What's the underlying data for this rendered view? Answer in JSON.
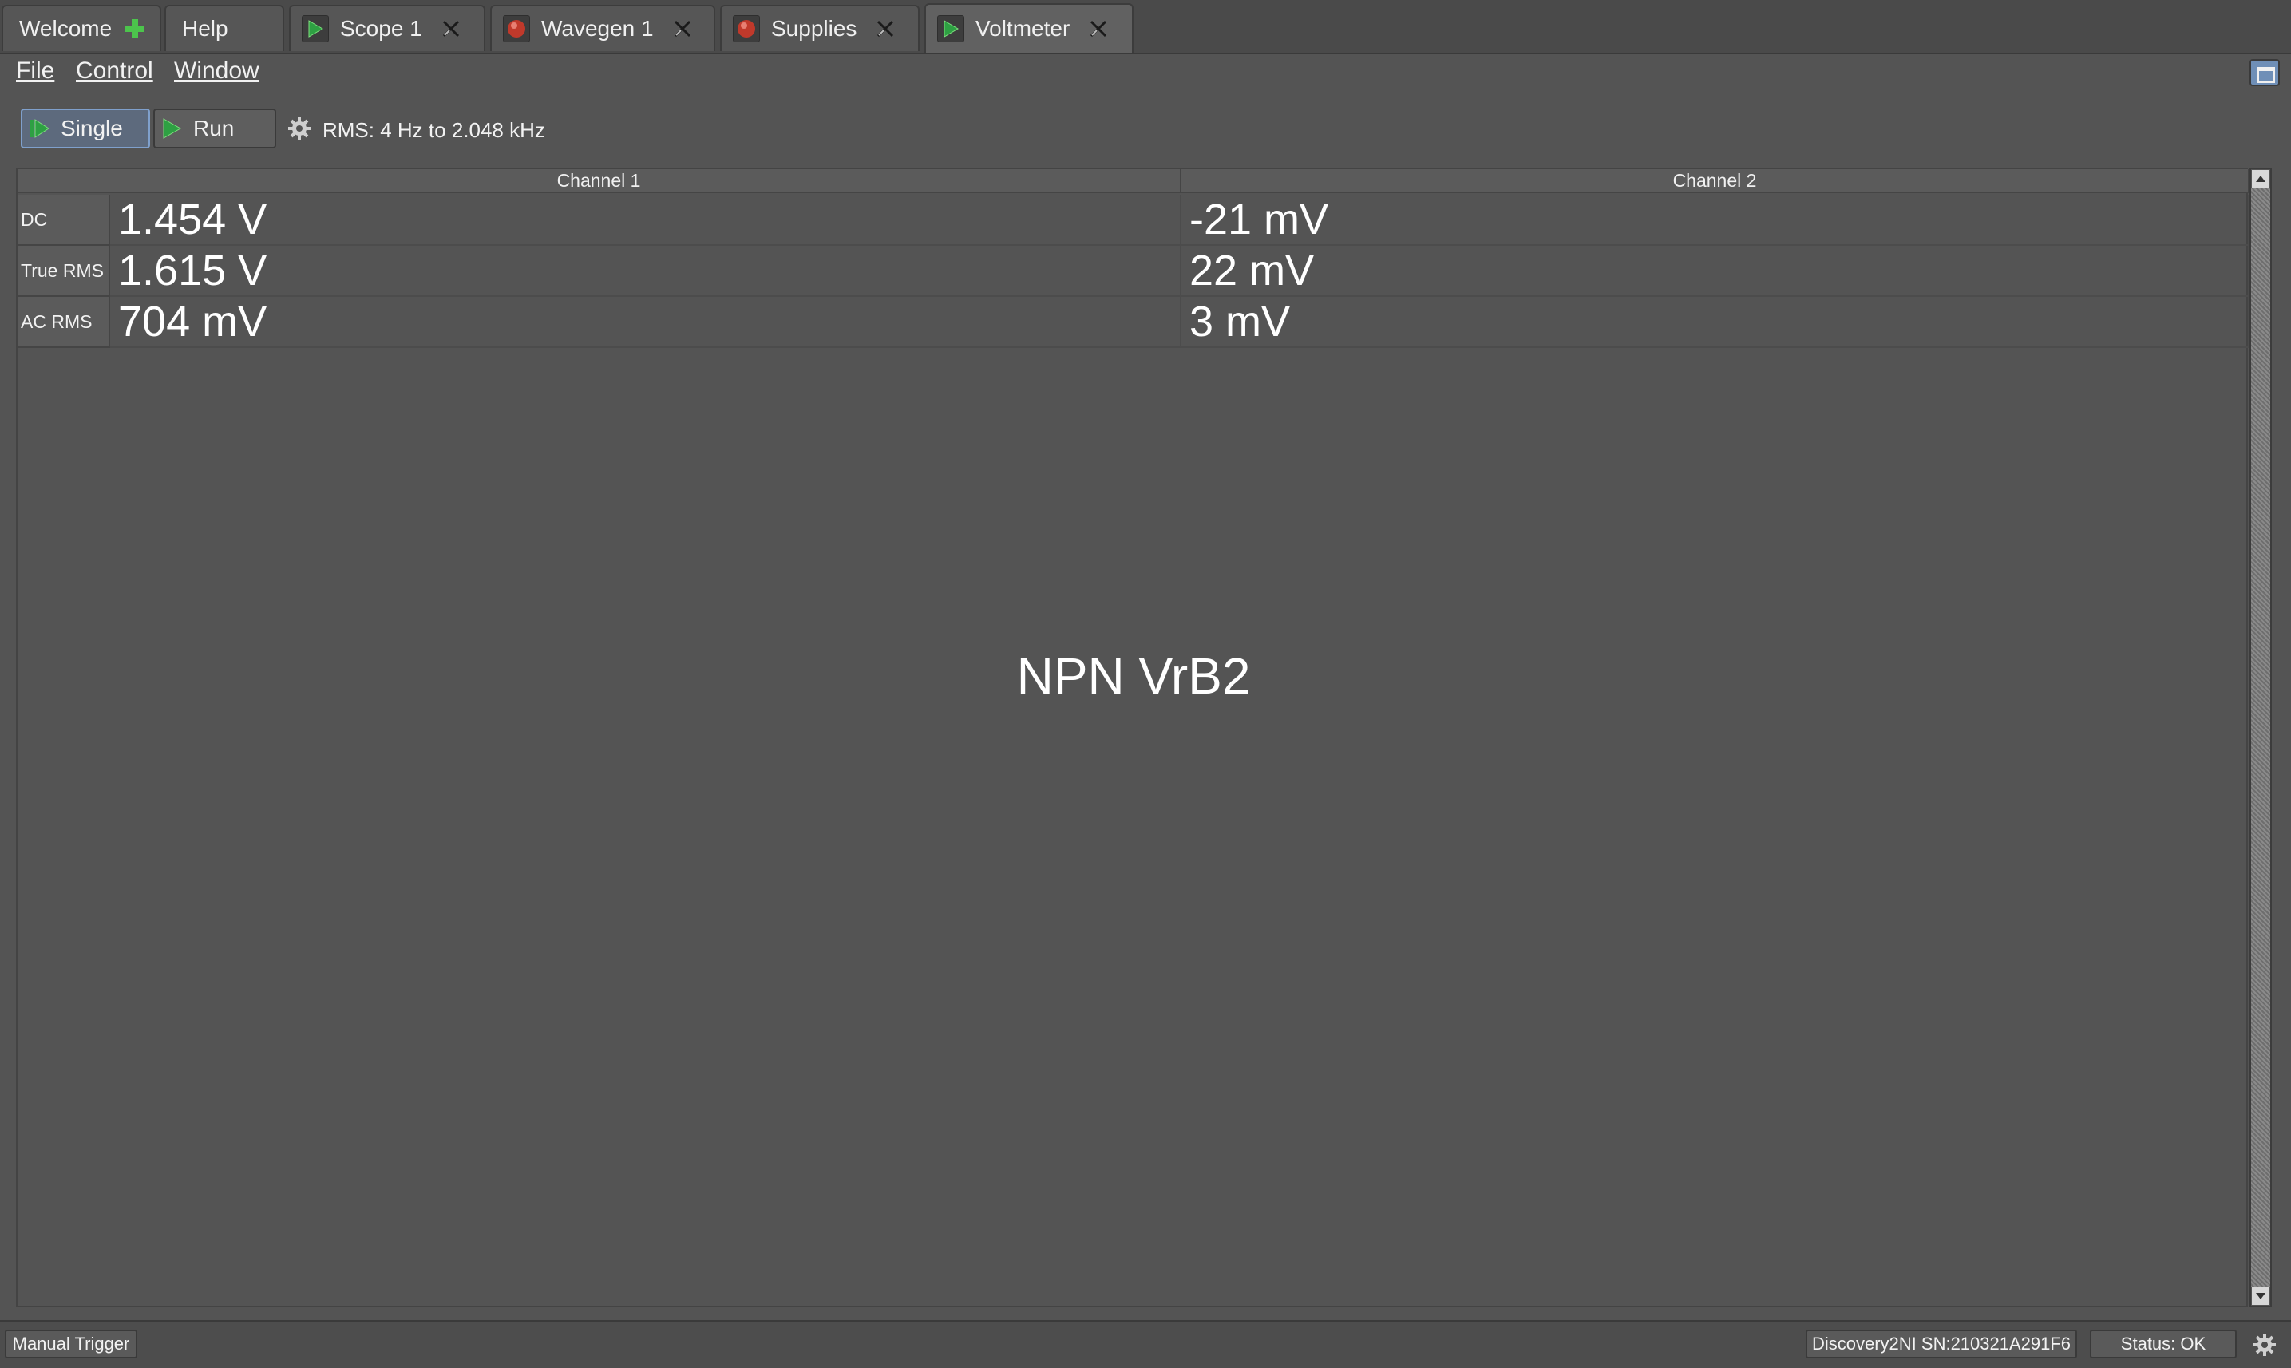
{
  "tabs": [
    {
      "label": "Welcome",
      "icon": "plus-icon"
    },
    {
      "label": "Help"
    },
    {
      "label": "Scope 1",
      "icon": "play-icon"
    },
    {
      "label": "Wavegen 1",
      "icon": "record-icon"
    },
    {
      "label": "Supplies",
      "icon": "record-icon"
    },
    {
      "label": "Voltmeter",
      "icon": "play-icon",
      "active": true
    }
  ],
  "menu": {
    "file": "File",
    "control": "Control",
    "window": "Window"
  },
  "toolbar": {
    "single_label": "Single",
    "run_label": "Run",
    "rms_text": "RMS: 4 Hz to 2.048 kHz"
  },
  "table": {
    "columns": [
      "Channel 1",
      "Channel 2"
    ],
    "rows": [
      {
        "label": "DC",
        "ch1": "1.454 V",
        "ch2": "-21 mV"
      },
      {
        "label": "True RMS",
        "ch1": "1.615 V",
        "ch2": "22 mV"
      },
      {
        "label": "AC RMS",
        "ch1": "704 mV",
        "ch2": "3 mV"
      }
    ]
  },
  "watermark": "NPN VrB2",
  "status": {
    "manual_trigger": "Manual Trigger",
    "device": "Discovery2NI SN:210321A291F6",
    "status_text": "Status: OK"
  },
  "colors": {
    "background": "#545454",
    "accent": "#7fa0cc",
    "play_green": "#2ea043",
    "record_red": "#c0392b"
  }
}
